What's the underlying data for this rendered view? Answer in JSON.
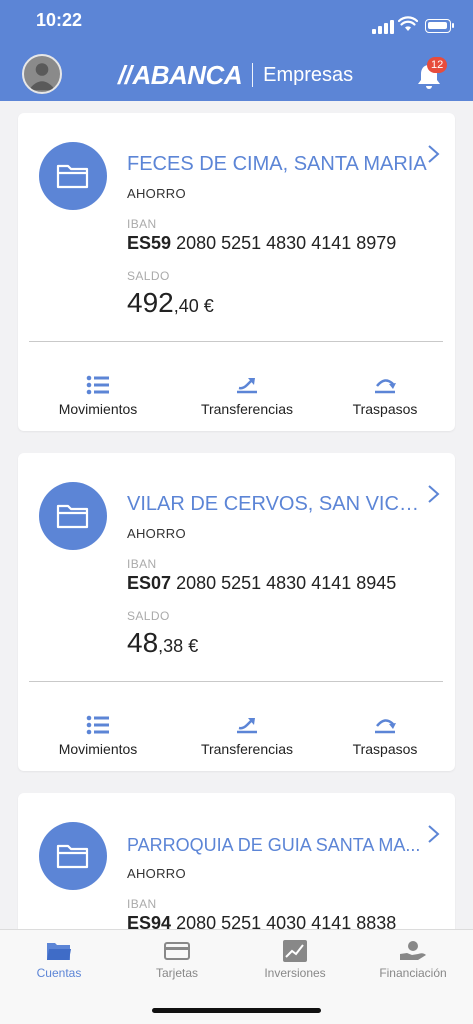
{
  "status_bar": {
    "time": "10:22"
  },
  "header": {
    "brand": "ABANCA",
    "brand_prefix": "//",
    "subtitle": "Empresas",
    "notifications_count": "12"
  },
  "accounts": [
    {
      "name": "FECES DE CIMA, SANTA MARIA",
      "type": "AHORRO",
      "iban_label": "IBAN",
      "iban_country": "ES59",
      "iban_number": "2080 5251 4830 4141 8979",
      "saldo_label": "SALDO",
      "saldo_int": "492",
      "saldo_dec": ",40",
      "currency": "€",
      "actions": {
        "movements": "Movimientos",
        "transfers": "Transferencias",
        "traspasos": "Traspasos"
      }
    },
    {
      "name": "VILAR DE CERVOS, SAN VICENTE",
      "type": "AHORRO",
      "iban_label": "IBAN",
      "iban_country": "ES07",
      "iban_number": "2080 5251 4830 4141 8945",
      "saldo_label": "SALDO",
      "saldo_int": "48",
      "saldo_dec": ",38",
      "currency": "€",
      "actions": {
        "movements": "Movimientos",
        "transfers": "Transferencias",
        "traspasos": "Traspasos"
      }
    },
    {
      "name": "PARROQUIA DE GUIA SANTA MA...",
      "type": "AHORRO",
      "iban_label": "IBAN",
      "iban_country": "ES94",
      "iban_number": "2080 5251 4030 4141 8838"
    }
  ],
  "tabbar": {
    "tabs": [
      {
        "label": "Cuentas",
        "icon": "folder-icon",
        "active": true
      },
      {
        "label": "Tarjetas",
        "icon": "card-icon",
        "active": false
      },
      {
        "label": "Inversiones",
        "icon": "chart-icon",
        "active": false
      },
      {
        "label": "Financiación",
        "icon": "financing-icon",
        "active": false
      }
    ]
  },
  "colors": {
    "primary": "#5c85d6",
    "badge": "#e74c3c"
  }
}
